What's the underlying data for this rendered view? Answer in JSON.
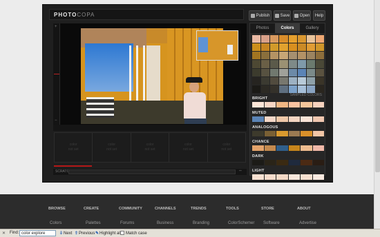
{
  "app": {
    "logo_main": "PHOTO",
    "logo_sub": "COPA",
    "buttons": {
      "publish": "Publish",
      "save": "Save",
      "open": "Open",
      "help": "Help"
    }
  },
  "viewer": {
    "slot_text_line1": "color",
    "slot_text_line2": "not set",
    "search_label": "SCRATCH"
  },
  "side": {
    "tabs": [
      "Photos",
      "Colors",
      "Gallery"
    ],
    "active_tab": "Colors",
    "sampled_label": "SAMPLED COLORS",
    "grid_colors": [
      "#e9b9a4",
      "#d8a089",
      "#d99a5f",
      "#d98d2a",
      "#e6a02d",
      "#d99730",
      "#e8c39a",
      "#efa873",
      "#cc8f1c",
      "#c58522",
      "#d19a2a",
      "#e1a12e",
      "#d88f1f",
      "#ca8a26",
      "#e09c34",
      "#d0962a",
      "#a27521",
      "#8a6f3c",
      "#b49364",
      "#c7a676",
      "#a79070",
      "#b39266",
      "#9c8460",
      "#8d6e3c",
      "#4d4833",
      "#6a5f46",
      "#5b5a4a",
      "#9b9173",
      "#7e8a88",
      "#7f9aaa",
      "#6b7a6e",
      "#4a4837",
      "#3c3b2d",
      "#575241",
      "#71796f",
      "#a0a19a",
      "#6c8aa8",
      "#5b84b6",
      "#7b8a89",
      "#5a5240",
      "#262420",
      "#3b3a31",
      "#514b3e",
      "#78786f",
      "#9db1c2",
      "#b8cad8",
      "#8ea0a8",
      "#3a3428",
      "#1b1a16",
      "#2c2a24",
      "#34312a",
      "#5f6f80",
      "#7ca1c9",
      "#a6bfd9",
      "#8aa4c2",
      "#2a261f"
    ],
    "sections": [
      {
        "label": "BRIGHT",
        "colors": [
          "#fde6d8",
          "#f8d7c5",
          "#f0b784",
          "#f9c3a1",
          "#f4c69b",
          "#f6d2be"
        ]
      },
      {
        "label": "MUTED",
        "colors": [
          "#5b84b6",
          "#f5d8c8",
          "#efc8a8",
          "#f4d5c1",
          "#f8e3d6",
          "#f0c7b0"
        ]
      },
      {
        "label": "ANALOGOUS",
        "colors": [
          "#3d3a2c",
          "#7a6034",
          "#d99a2f",
          "#9a7a52",
          "#d9902a",
          "#f2c6a6"
        ]
      },
      {
        "label": "CHANCE",
        "colors": [
          "#e3a36b",
          "#c48a4f",
          "#2f5f8c",
          "#c7861c",
          "#eebc8f",
          "#f0b8a8"
        ]
      },
      {
        "label": "DARK",
        "colors": [
          "#1c1b17",
          "#2a2418",
          "#3a2a12",
          "#1f2a3d",
          "#4b2a14",
          "#2a1d14"
        ]
      },
      {
        "label": "LIGHT",
        "colors": [
          "#f8e1d2",
          "#f6dccb",
          "#f4d9c6",
          "#f9e7dc",
          "#f7e0d0",
          "#fbeae0"
        ]
      }
    ]
  },
  "footer": {
    "nav": [
      "BROWSE",
      "CREATE",
      "COMMUNITY",
      "CHANNELS",
      "TRENDS",
      "TOOLS",
      "STORE",
      "ABOUT"
    ],
    "sub": [
      "Colors",
      "Palettes",
      "Forums",
      "Business",
      "Branding",
      "ColorSchemer",
      "Software",
      "Advertise"
    ]
  },
  "findbar": {
    "find_label": "Find:",
    "query": "color explore",
    "next": "Next",
    "previous": "Previous",
    "highlight": "Highlight all",
    "match_case": "Match case"
  }
}
